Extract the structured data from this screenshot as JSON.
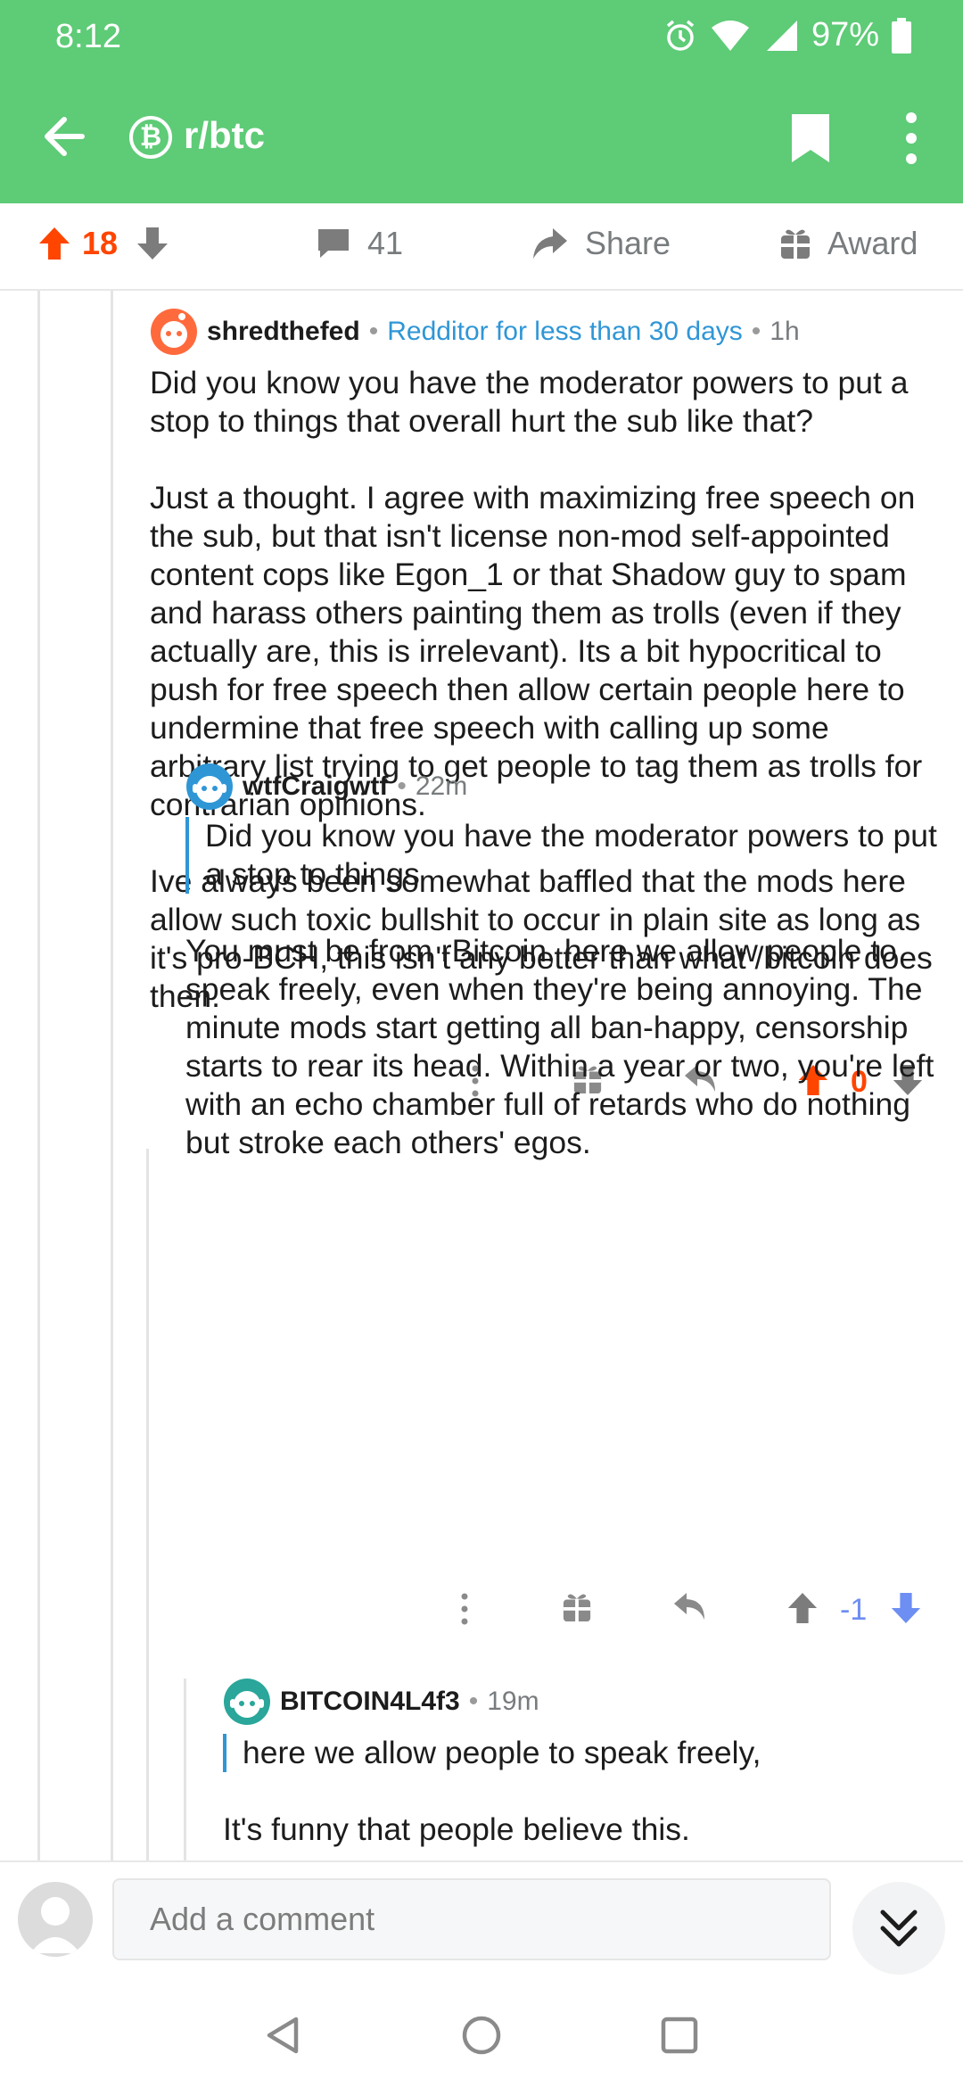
{
  "status": {
    "time": "8:12",
    "battery": "97%"
  },
  "header": {
    "subreddit": "r/btc",
    "sub_icon": "₿"
  },
  "post_actions": {
    "score": "18",
    "comments": "41",
    "share": "Share",
    "award": "Award"
  },
  "comments": [
    {
      "author": "shredthefed",
      "flair": "Redditor for less than 30 days",
      "time": "1h",
      "paragraphs": [
        "Did you know you have the moderator powers to put a stop to things that overall hurt the sub like that?",
        "Just a thought. I agree with maximizing free speech on the sub, but that isn't license non-mod self-appointed content cops like Egon_1 or that Shadow guy to spam and harass others painting them as trolls (even if they actually are, this is irrelevant). Its a bit hypocritical to push for free speech then allow certain people here to undermine that free speech with calling up some arbitrary list trying to get people to tag them as trolls for contrarian opinions.",
        "Ive always been somewhat baffled that the mods here allow such toxic bullshit to occur in plain site as long as it's pro-BCH, this isn't any better than what /bitcoin does then."
      ],
      "score": "0"
    },
    {
      "author": "wtfCraigwtf",
      "time": "22m",
      "quote": "Did you know you have the moderator powers to put a stop to things",
      "paragraphs": [
        "You must be from rBitcoin, here we allow people to speak freely, even when they're being annoying. The minute mods start getting all ban-happy, censorship starts to rear its head. Within a year or two, you're left with an echo chamber full of retards who do nothing but stroke each others' egos."
      ],
      "score": "-1"
    },
    {
      "author": "BITCOIN4L4f3",
      "time": "19m",
      "quote": "here we allow people to speak freely,",
      "paragraphs": [
        "It's funny that people believe this."
      ]
    }
  ],
  "composer": {
    "placeholder": "Add a comment"
  },
  "colors": {
    "app_bar": "#5ecb77",
    "upvote": "#ff4500",
    "downvote": "#6d8ef2",
    "flair": "#2f96d6"
  },
  "icons": [
    "back-arrow-icon",
    "bitcoin-icon",
    "bookmark-icon",
    "more-vert-icon",
    "upvote-icon",
    "downvote-icon",
    "comment-icon",
    "share-icon",
    "gift-icon",
    "reply-icon",
    "chevron-double-down-icon"
  ]
}
